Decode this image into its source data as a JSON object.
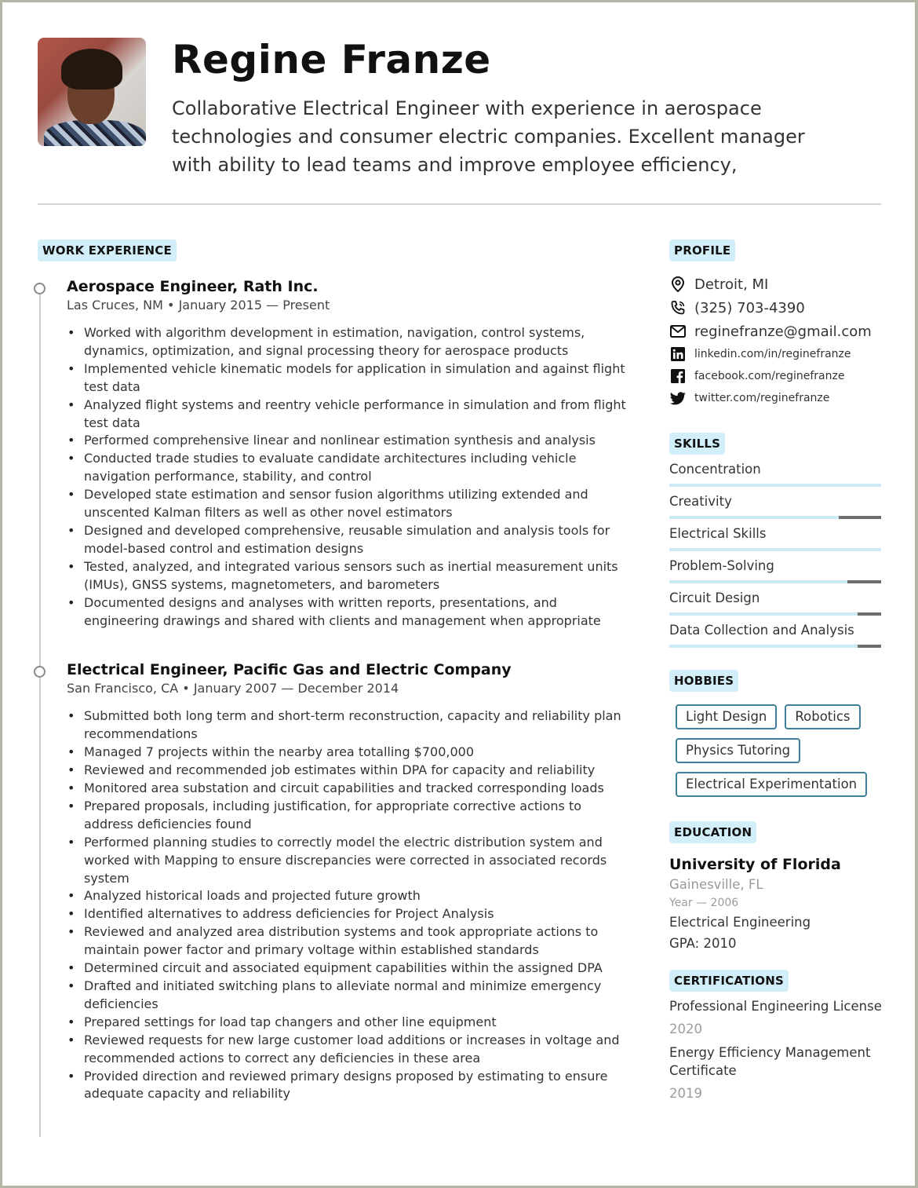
{
  "header": {
    "name": "Regine Franze",
    "summary": "Collaborative Electrical Engineer with experience in aerospace technologies and consumer electric companies. Excellent manager with ability to lead teams and improve employee efficiency,",
    "photo_alt": "profile-photo"
  },
  "work": {
    "heading": "WORK EXPERIENCE",
    "jobs": [
      {
        "title": "Aerospace Engineer, Rath Inc.",
        "meta": "Las Cruces, NM • January 2015 — Present",
        "bullets": [
          "Worked with algorithm development in estimation, navigation, control systems, dynamics, optimization, and signal processing theory for aerospace products",
          "Implemented vehicle kinematic models for application in simulation and against flight test data",
          "Analyzed flight systems and reentry vehicle performance in simulation and from flight test data",
          "Performed comprehensive linear and nonlinear estimation synthesis and analysis",
          "Conducted trade studies to evaluate candidate architectures including vehicle navigation performance, stability, and control",
          "Developed state estimation and sensor fusion algorithms utilizing extended and unscented Kalman filters as well as other novel estimators",
          "Designed and developed comprehensive, reusable simulation and analysis tools for model-based control and estimation designs",
          "Tested, analyzed, and integrated various sensors such as inertial measurement units (IMUs), GNSS systems, magnetometers, and barometers",
          "Documented designs and analyses with written reports, presentations, and engineering drawings and shared with clients and management when appropriate"
        ]
      },
      {
        "title": "Electrical Engineer, Pacific Gas and Electric Company",
        "meta": "San Francisco, CA • January 2007 — December 2014",
        "bullets": [
          "Submitted both long term and short-term reconstruction, capacity and reliability plan recommendations",
          "Managed 7 projects within the nearby area totalling $700,000",
          "Reviewed and recommended job estimates within DPA for capacity and reliability",
          "Monitored area substation and circuit capabilities and tracked corresponding loads",
          "Prepared proposals, including justification, for appropriate corrective actions to address deficiencies found",
          "Performed planning studies to correctly model the electric distribution system and worked with Mapping to ensure discrepancies were corrected in associated records system",
          "Analyzed historical loads and projected future growth",
          "Identified alternatives to address deficiencies for Project Analysis",
          "Reviewed and analyzed area distribution systems and took appropriate actions to maintain power factor and primary voltage within established standards",
          "Determined circuit and associated equipment capabilities within the assigned DPA",
          "Drafted and initiated switching plans to alleviate normal and minimize emergency deficiencies",
          "Prepared settings for load tap changers and other line equipment",
          "Reviewed requests for new large customer load additions or increases in voltage and recommended actions to correct any deficiencies in these area",
          "Provided direction and reviewed primary designs proposed by estimating to ensure adequate capacity and reliability"
        ]
      }
    ]
  },
  "profile": {
    "heading": "PROFILE",
    "location": "Detroit, MI",
    "phone": "(325) 703-4390",
    "email": "reginefranze@gmail.com",
    "linkedin": "linkedin.com/in/reginefranze",
    "facebook": "facebook.com/reginefranze",
    "twitter": "twitter.com/reginefranze"
  },
  "skills": {
    "heading": "SKILLS",
    "items": [
      {
        "name": "Concentration",
        "level_pct": 100
      },
      {
        "name": "Creativity",
        "level_pct": 80
      },
      {
        "name": "Electrical Skills",
        "level_pct": 100
      },
      {
        "name": "Problem-Solving",
        "level_pct": 84
      },
      {
        "name": "Circuit Design",
        "level_pct": 89
      },
      {
        "name": "Data Collection and Analysis",
        "level_pct": 89
      }
    ]
  },
  "hobbies": {
    "heading": "HOBBIES",
    "items": [
      "Light Design",
      "Robotics",
      "Physics Tutoring",
      "Electrical Experimentation"
    ]
  },
  "education": {
    "heading": "EDUCATION",
    "school": "University of Florida",
    "city": "Gainesville, FL",
    "year": "Year — 2006",
    "degree": "Electrical Engineering",
    "gpa": "GPA: 2010"
  },
  "certifications": {
    "heading": "CERTIFICATIONS",
    "items": [
      {
        "name": "Professional Engineering License",
        "year": "2020"
      },
      {
        "name": "Energy Efficiency Management Certificate",
        "year": "2019"
      }
    ]
  },
  "colors": {
    "tag_bg": "#d2eef9",
    "skill_fill": "#cdebf5",
    "skill_remaining": "#6e6e6e",
    "hobby_border": "#3f7f9a",
    "frame": "#b3b6a6"
  }
}
